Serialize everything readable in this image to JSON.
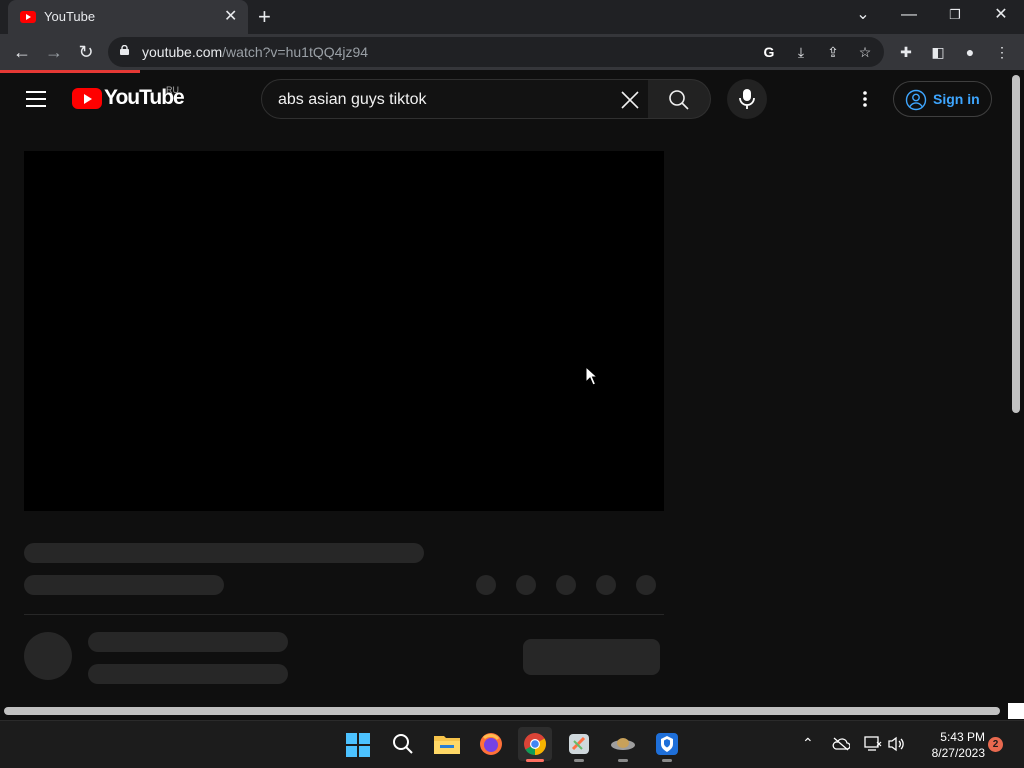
{
  "browser": {
    "tab_title": "YouTube",
    "url_domain": "youtube.com",
    "url_path": "/watch?v=hu1tQQ4jz94",
    "icons": [
      "back-icon",
      "forward-icon",
      "reload-icon",
      "lock-icon",
      "google-icon",
      "install-icon",
      "share-icon",
      "star-icon",
      "extensions-icon",
      "side-panel-icon",
      "profile-icon",
      "menu-icon"
    ]
  },
  "youtube": {
    "logo_text": "YouTube",
    "region": "RU",
    "search_value": "abs asian guys tiktok",
    "signin_label": "Sign in"
  },
  "taskbar": {
    "time": "5:43 PM",
    "date": "8/27/2023",
    "notification_count": "2",
    "apps": [
      "windows-start",
      "search",
      "file-explorer",
      "firefox",
      "chrome",
      "app-icon",
      "app-icon-2",
      "security-app"
    ]
  },
  "colors": {
    "youtube_red": "#ff0000",
    "link_blue": "#3ea6ff",
    "page_bg": "#0f0f0f",
    "skeleton": "#272727"
  }
}
